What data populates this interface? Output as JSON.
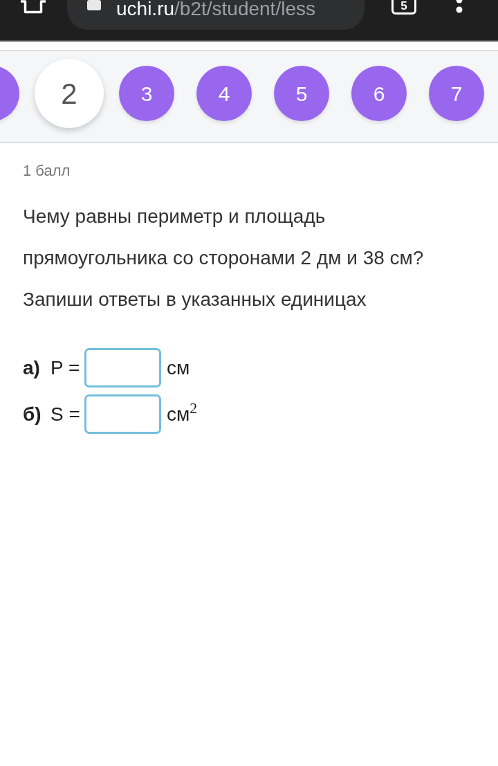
{
  "browser": {
    "url": {
      "host": "uchi.ru",
      "path": "/b2t/student/less"
    },
    "tab_count": "5"
  },
  "task_nav": {
    "items": [
      {
        "selected": false
      },
      {
        "label": "2",
        "selected": true
      },
      {
        "label": "3",
        "selected": false
      },
      {
        "label": "4",
        "selected": false
      },
      {
        "label": "5",
        "selected": false
      },
      {
        "label": "6",
        "selected": false
      },
      {
        "label": "7",
        "selected": false
      }
    ]
  },
  "task": {
    "points": "1 балл",
    "question": "Чему равны периметр и площадь прямоугольника со сторонами 2 дм и 38 см?",
    "instruction": "Запиши ответы в указанных единицах",
    "answers": [
      {
        "letter": "а)",
        "variable": "P =",
        "unit": "см"
      },
      {
        "letter": "б)",
        "variable": "S =",
        "unit": "см$^{2}$"
      }
    ]
  }
}
